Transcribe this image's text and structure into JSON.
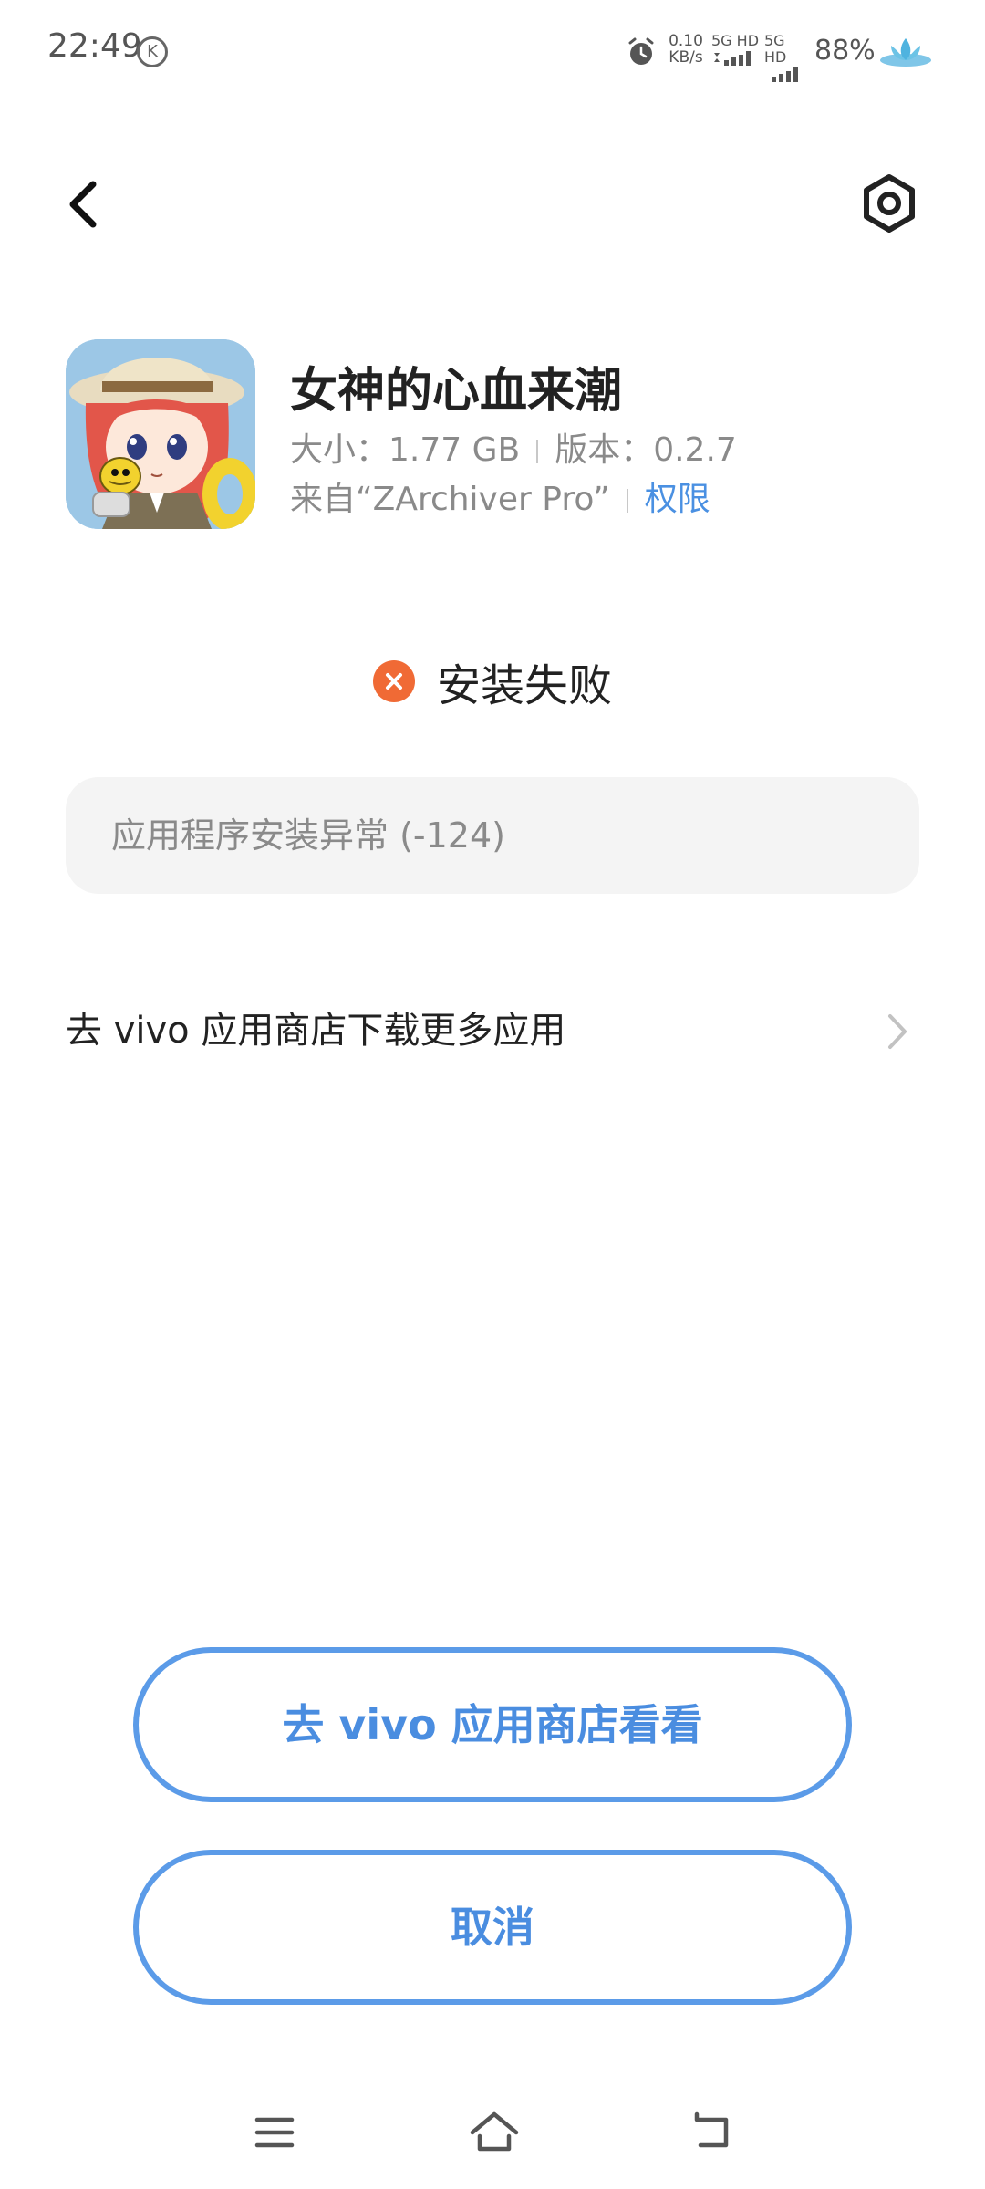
{
  "status_bar": {
    "time": "22:49",
    "k_badge": "K",
    "net_speed_value": "0.10",
    "net_speed_unit": "KB/s",
    "sim1_label": "5G HD",
    "sim2_label": "5G HD",
    "battery": "88%",
    "icons": [
      "alarm-icon",
      "signal-icon",
      "lotus-icon"
    ]
  },
  "header": {
    "back_icon": "chevron-left-icon",
    "settings_icon": "hexagon-settings-icon"
  },
  "app": {
    "name": "女神的心血来潮",
    "size": "大小：1.77 GB",
    "version": "版本：0.2.7",
    "source": "来自“ZArchiver Pro”",
    "permissions": "权限"
  },
  "install": {
    "status": "安装失败",
    "error": "应用程序安装异常 (-124)"
  },
  "store_link": {
    "label": "去 vivo 应用商店下载更多应用"
  },
  "buttons": {
    "open_store": "去 vivo 应用商店看看",
    "cancel": "取消"
  },
  "colors": {
    "accent": "#4a8de0",
    "error": "#f06a35"
  }
}
